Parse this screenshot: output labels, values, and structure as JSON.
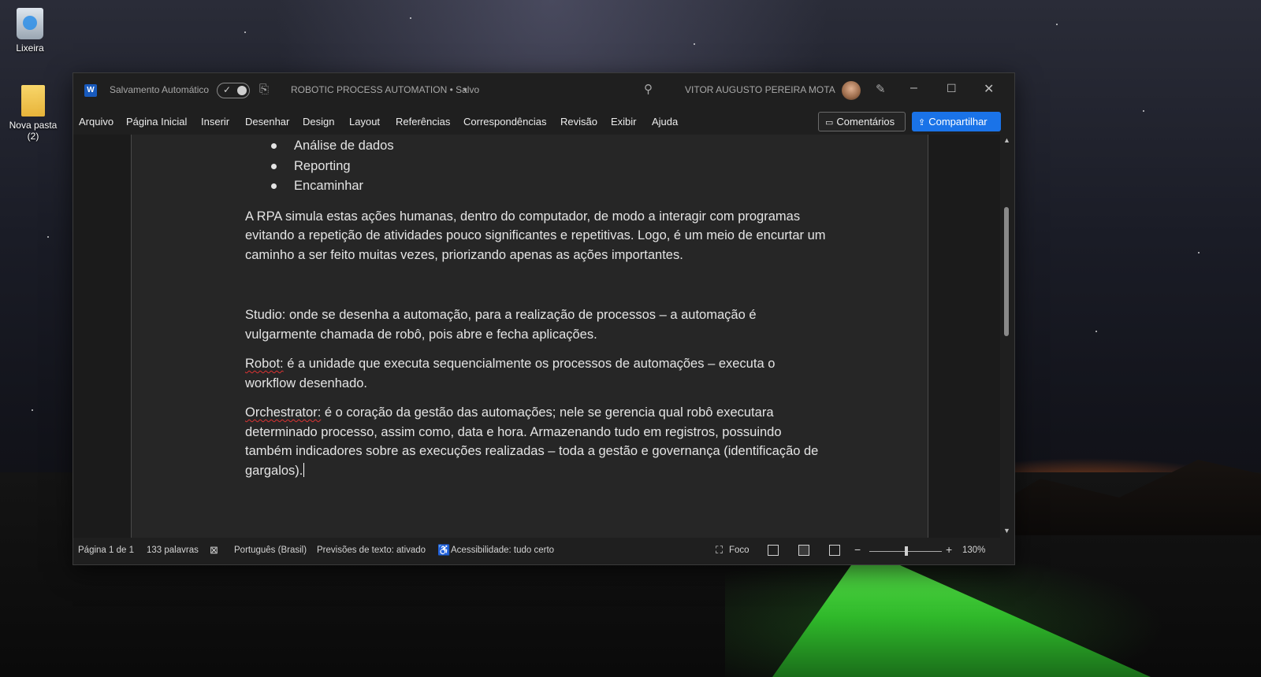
{
  "desktop": {
    "icons": [
      {
        "label": "Lixeira"
      },
      {
        "label": "Nova pasta (2)"
      }
    ]
  },
  "titlebar": {
    "app_letter": "W",
    "autosave_label": "Salvamento Automático",
    "doc_title": "ROBOTIC PROCESS AUTOMATION • Salvo",
    "user_name": "VITOR AUGUSTO PEREIRA MOTA"
  },
  "menu": {
    "items": [
      "Arquivo",
      "Página Inicial",
      "Inserir",
      "Desenhar",
      "Design",
      "Layout",
      "Referências",
      "Correspondências",
      "Revisão",
      "Exibir",
      "Ajuda"
    ],
    "comments_label": "Comentários",
    "share_label": "Compartilhar"
  },
  "document": {
    "bullets": [
      "Análise de dados",
      "Reporting",
      "Encaminhar"
    ],
    "para1": "A RPA simula estas ações humanas, dentro do computador, de modo a interagir com programas evitando a repetição de atividades pouco significantes e repetitivas. Logo, é um meio de encurtar um caminho a ser feito muitas vezes, priorizando apenas as ações importantes.",
    "para2": "Studio: onde se desenha a automação, para a realização de processos – a automação é vulgarmente chamada de robô, pois abre e fecha aplicações.",
    "para3_term": "Robot:",
    "para3_rest": " é a unidade que executa sequencialmente os processos de automações – executa o workflow desenhado.",
    "para4_term": "Orchestrator:",
    "para4_rest": " é o coração da gestão das automações; nele se gerencia qual robô executara determinado processo, assim como, data e hora. Armazenando tudo em registros, possuindo também indicadores sobre as execuções realizadas – toda a gestão e governança (identificação de gargalos)."
  },
  "status": {
    "page": "Página 1 de 1",
    "words": "133 palavras",
    "language": "Português (Brasil)",
    "predictions": "Previsões de texto: ativado",
    "accessibility": "Acessibilidade: tudo certo",
    "focus": "Foco",
    "zoom": "130%"
  }
}
